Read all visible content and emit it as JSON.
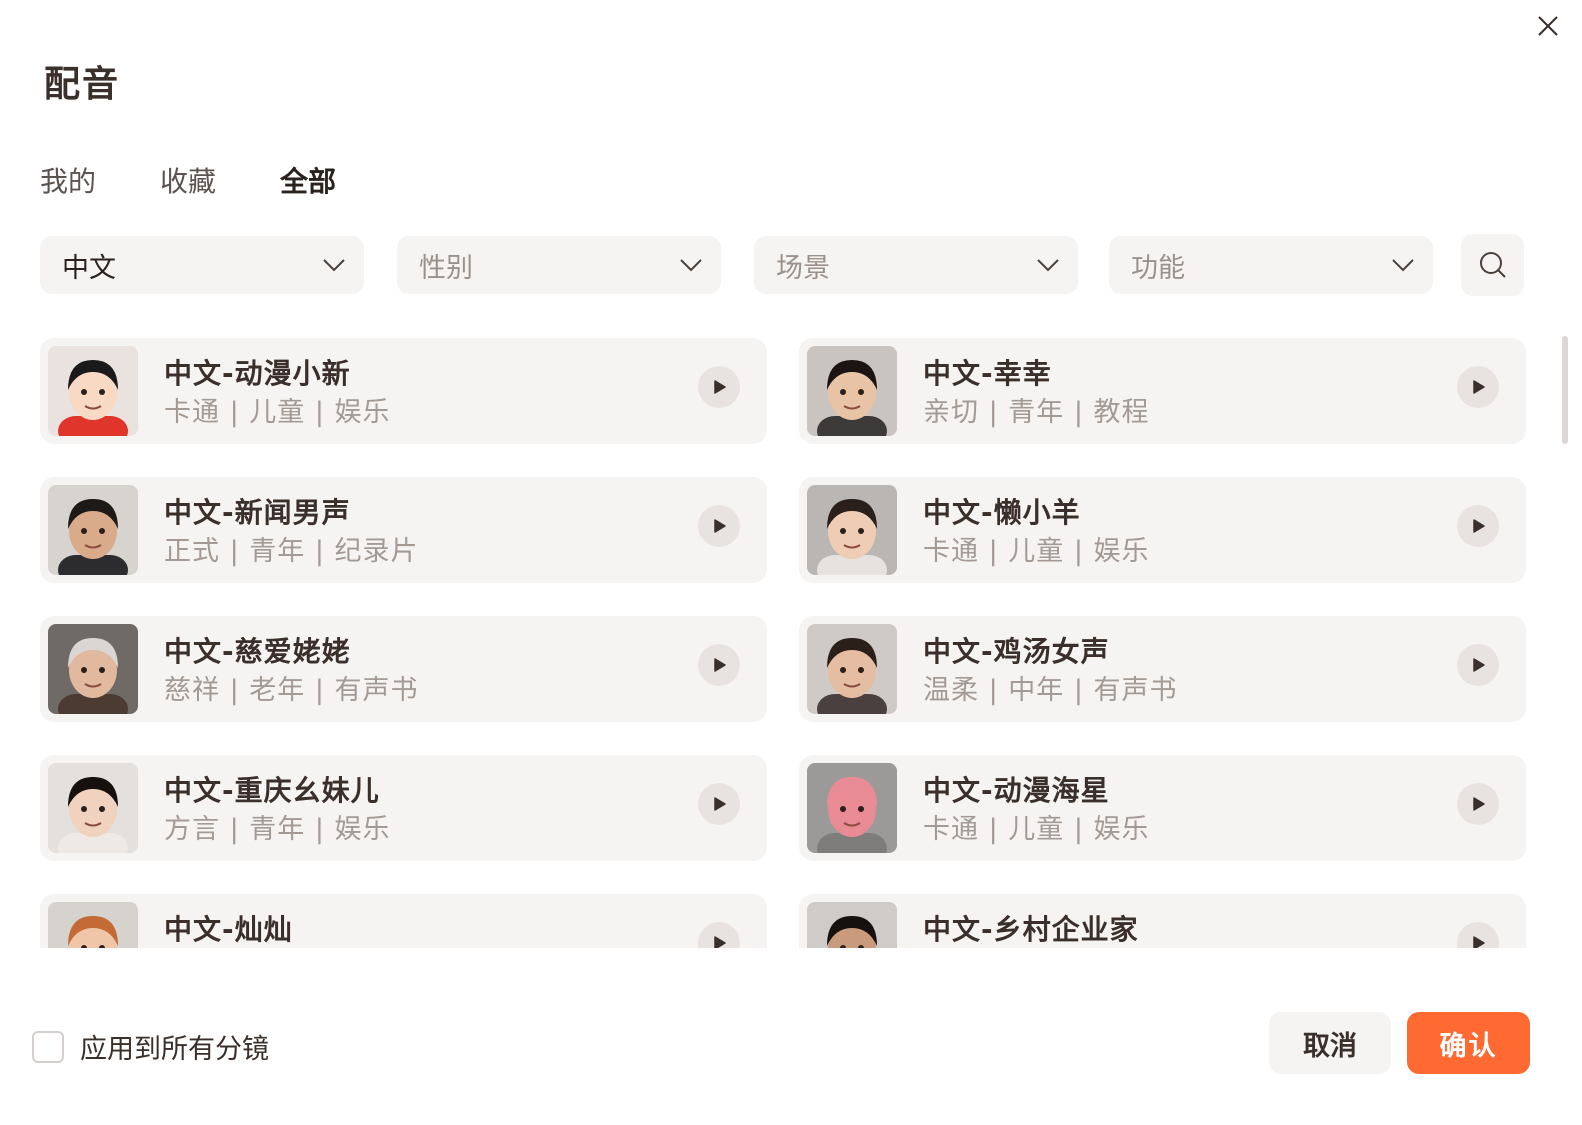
{
  "dialog": {
    "title": "配音",
    "tabs": [
      {
        "label": "我的",
        "active": false
      },
      {
        "label": "收藏",
        "active": false
      },
      {
        "label": "全部",
        "active": true
      }
    ],
    "filters": [
      {
        "label": "中文",
        "selected": true
      },
      {
        "label": "性别",
        "selected": false
      },
      {
        "label": "场景",
        "selected": false
      },
      {
        "label": "功能",
        "selected": false
      }
    ],
    "voices": [
      {
        "name": "中文-动漫小新",
        "tags": "卡通 | 儿童 | 娱乐",
        "avatar": "cartoon-boy-icon",
        "skin": "#f7d9c4",
        "hair": "#1a1a1a",
        "bg": "#e9e2de",
        "shirt": "#e0352b"
      },
      {
        "name": "中文-幸幸",
        "tags": "亲切 | 青年 | 教程",
        "avatar": "young-woman-icon",
        "skin": "#e8c3a6",
        "hair": "#1b1413",
        "bg": "#c9c4bf",
        "shirt": "#3d3a3a"
      },
      {
        "name": "中文-新闻男声",
        "tags": "正式 | 青年 | 纪录片",
        "avatar": "man-glasses-icon",
        "skin": "#d9ab8a",
        "hair": "#1e1a18",
        "bg": "#d7d3cf",
        "shirt": "#2c2c2e"
      },
      {
        "name": "中文-懒小羊",
        "tags": "卡通 | 儿童 | 娱乐",
        "avatar": "child-hood-icon",
        "skin": "#efcdb4",
        "hair": "#2a1f1b",
        "bg": "#b9b6b3",
        "shirt": "#e5e2df"
      },
      {
        "name": "中文-慈爱姥姥",
        "tags": "慈祥 | 老年 | 有声书",
        "avatar": "grandma-icon",
        "skin": "#e0b99f",
        "hair": "#d9d6d3",
        "bg": "#6f6a66",
        "shirt": "#4b3b33"
      },
      {
        "name": "中文-鸡汤女声",
        "tags": "温柔 | 中年 | 有声书",
        "avatar": "woman-glasses-icon",
        "skin": "#e4bda2",
        "hair": "#2b1f1a",
        "bg": "#cfcac6",
        "shirt": "#4a4040"
      },
      {
        "name": "中文-重庆幺妹儿",
        "tags": "方言 | 青年 | 娱乐",
        "avatar": "girl-icon",
        "skin": "#f0d2be",
        "hair": "#16110f",
        "bg": "#e3e0de",
        "shirt": "#efe9e6"
      },
      {
        "name": "中文-动漫海星",
        "tags": "卡通 | 儿童 | 娱乐",
        "avatar": "starfish-icon",
        "skin": "#e88b94",
        "hair": "#e88b94",
        "bg": "#9c9a99",
        "shirt": "#7f7d7c"
      },
      {
        "name": "中文-灿灿",
        "tags": "",
        "avatar": "redhead-woman-icon",
        "skin": "#efc6a8",
        "hair": "#c46a36",
        "bg": "#d6d2ce",
        "shirt": "#c9c1bc"
      },
      {
        "name": "中文-乡村企业家",
        "tags": "",
        "avatar": "man-icon",
        "skin": "#c99a7c",
        "hair": "#14110f",
        "bg": "#cfcbc8",
        "shirt": "#2b2b2b"
      }
    ],
    "apply_all_label": "应用到所有分镜",
    "cancel_label": "取消",
    "confirm_label": "确认",
    "accent_color": "#ff6a33"
  }
}
